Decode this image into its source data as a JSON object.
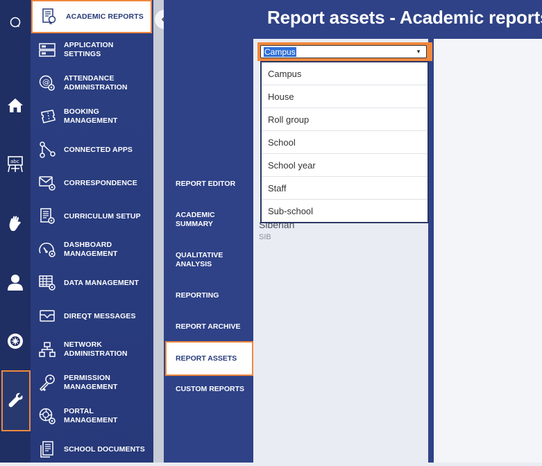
{
  "page_title": "Report assets - Academic reports",
  "rail": [
    {
      "icon": "search-icon"
    },
    {
      "icon": "home-icon"
    },
    {
      "icon": "teaching-icon"
    },
    {
      "icon": "hand-icon"
    },
    {
      "icon": "user-icon"
    },
    {
      "icon": "aperture-icon"
    },
    {
      "icon": "wrench-icon",
      "active": true
    }
  ],
  "admin_menu": [
    {
      "label": "ACADEMIC REPORTS",
      "icon": "academic-reports-icon",
      "active": true
    },
    {
      "label": "APPLICATION SETTINGS",
      "icon": "application-settings-icon"
    },
    {
      "label": "ATTENDANCE ADMINISTRATION",
      "icon": "attendance-icon"
    },
    {
      "label": "BOOKING MANAGEMENT",
      "icon": "booking-icon"
    },
    {
      "label": "CONNECTED APPS",
      "icon": "connected-apps-icon"
    },
    {
      "label": "CORRESPONDENCE",
      "icon": "correspondence-icon"
    },
    {
      "label": "CURRICULUM SETUP",
      "icon": "curriculum-icon"
    },
    {
      "label": "DASHBOARD MANAGEMENT",
      "icon": "dashboard-icon"
    },
    {
      "label": "DATA MANAGEMENT",
      "icon": "data-management-icon"
    },
    {
      "label": "DIREQT MESSAGES",
      "icon": "messages-icon"
    },
    {
      "label": "NETWORK ADMINISTRATION",
      "icon": "network-icon"
    },
    {
      "label": "PERMISSION MANAGEMENT",
      "icon": "key-icon"
    },
    {
      "label": "PORTAL MANAGEMENT",
      "icon": "portal-icon"
    },
    {
      "label": "SCHOOL DOCUMENTS",
      "icon": "documents-icon"
    }
  ],
  "sub_menu": [
    {
      "label": "REPORT EDITOR"
    },
    {
      "label": "ACADEMIC SUMMARY"
    },
    {
      "label": "QUALITATIVE ANALYSIS"
    },
    {
      "label": "REPORTING"
    },
    {
      "label": "REPORT ARCHIVE"
    },
    {
      "label": "REPORT ASSETS",
      "active": true
    },
    {
      "label": "CUSTOM REPORTS"
    }
  ],
  "asset_type_select": {
    "value": "Campus",
    "options": [
      "Campus",
      "House",
      "Roll group",
      "School",
      "School year",
      "Staff",
      "Sub-school"
    ]
  },
  "behind_list_item": {
    "name": "Siberian",
    "code": "SIB"
  }
}
